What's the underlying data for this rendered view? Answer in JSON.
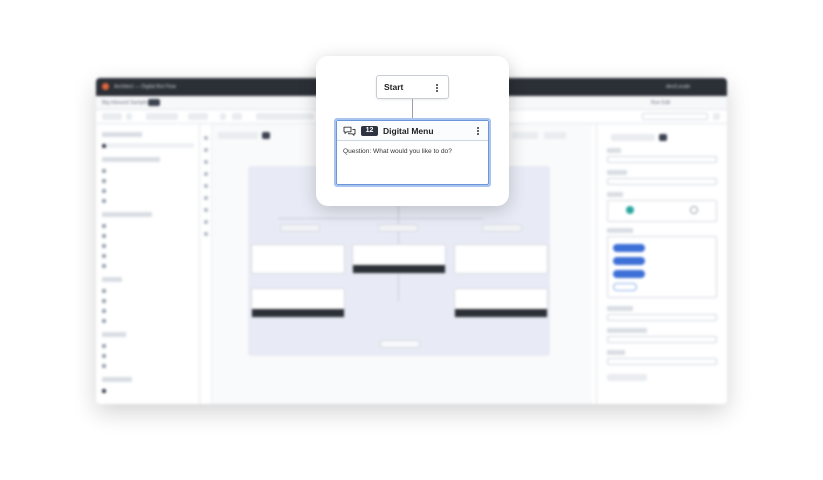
{
  "app": {
    "title_text": "Architect — Digital Bot Flow",
    "user_text": "dev/Locale",
    "subbar_left": "Big Inbound Sample",
    "subbar_right": "Run Edit"
  },
  "popup": {
    "start_node": {
      "label": "Start"
    },
    "menu_node": {
      "count": "12",
      "title": "Digital Menu",
      "question": "Question: What would you like to do?"
    }
  },
  "colors": {
    "selection_border": "#6b96da",
    "count_badge": "#2d3340",
    "accent_blue": "#3d6fd8"
  },
  "icons": {
    "menu_type": "comments-icon",
    "options": "kebab-menu-icon"
  }
}
